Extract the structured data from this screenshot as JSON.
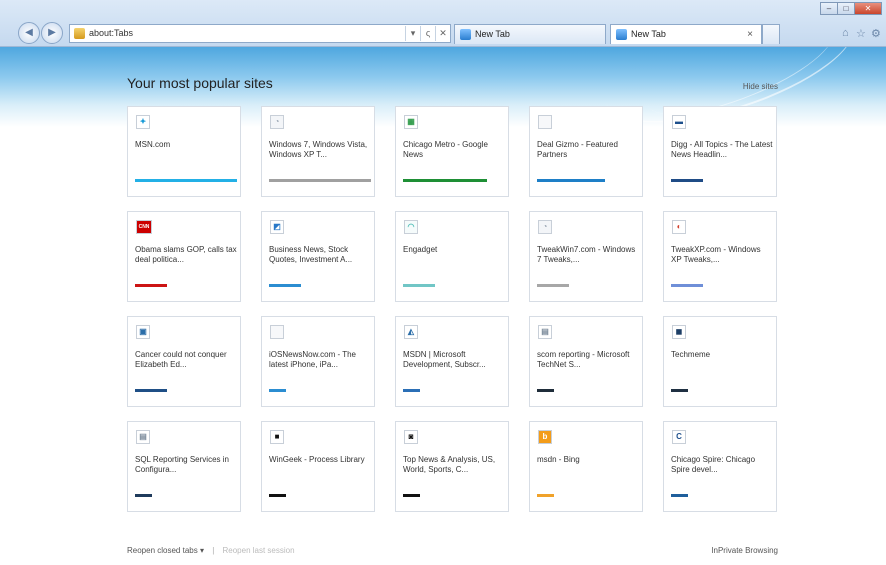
{
  "browser": {
    "address": "about:Tabs",
    "tabs": [
      {
        "label": "New Tab"
      },
      {
        "label": "New Tab"
      }
    ],
    "tab_close": "×",
    "address_controls": [
      "▾",
      "ς",
      "✕"
    ],
    "window_controls": {
      "minimize": "–",
      "maximize": "□",
      "close": "✕"
    }
  },
  "page": {
    "heading": "Your most popular sites",
    "hide_sites": "Hide sites",
    "reopen_closed": "Reopen closed tabs ▾",
    "reopen_last": "Reopen last session",
    "inprivate": "InPrivate Browsing"
  },
  "tiles": [
    {
      "title": "MSN.com",
      "icon": "msn-butterfly-icon",
      "glyph": "✦",
      "icon_color": "#1a9bd7",
      "icon_bg": "#ffffff",
      "bar_color": "#23b0e6",
      "bar_width": 102
    },
    {
      "title": "Windows 7, Windows Vista, Windows XP T...",
      "icon": "generic-page-icon",
      "glyph": "◔",
      "icon_color": "#9aa6b2",
      "icon_bg": "#f3f5f8",
      "bar_color": "#a0a0a0",
      "bar_width": 102
    },
    {
      "title": "Chicago Metro - Google News",
      "icon": "google-news-icon",
      "glyph": "▦",
      "icon_color": "#2f9b4a",
      "icon_bg": "#ffffff",
      "bar_color": "#1e8f35",
      "bar_width": 84
    },
    {
      "title": "Deal Gizmo - Featured Partners",
      "icon": "blank-page-icon",
      "glyph": "",
      "icon_color": "#bbbbbb",
      "icon_bg": "#f7f8fa",
      "bar_color": "#1e7fc7",
      "bar_width": 68
    },
    {
      "title": "Digg - All Topics - The Latest News Headlin...",
      "icon": "digg-icon",
      "glyph": "▬",
      "icon_color": "#1d4f8c",
      "icon_bg": "#ffffff",
      "bar_color": "#1f4c86",
      "bar_width": 32
    },
    {
      "title": "Obama slams GOP, calls tax deal politica...",
      "icon": "cnn-icon",
      "glyph": "CNN",
      "icon_color": "#ffffff",
      "icon_bg": "#cc0000",
      "bar_color": "#cc1414",
      "bar_width": 32
    },
    {
      "title": "Business News, Stock Quotes, Investment A...",
      "icon": "chart-icon",
      "glyph": "◩",
      "icon_color": "#2878c8",
      "icon_bg": "#ffffff",
      "bar_color": "#2b8dd1",
      "bar_width": 32
    },
    {
      "title": "Engadget",
      "icon": "engadget-icon",
      "glyph": "◠",
      "icon_color": "#59c0ba",
      "icon_bg": "#f5fbfb",
      "bar_color": "#71c6c6",
      "bar_width": 32
    },
    {
      "title": "TweakWin7.com - Windows 7 Tweaks,...",
      "icon": "generic-page-icon",
      "glyph": "◔",
      "icon_color": "#9aa6b2",
      "icon_bg": "#f3f5f8",
      "bar_color": "#a7a7a7",
      "bar_width": 32
    },
    {
      "title": "TweakXP.com - Windows XP Tweaks,...",
      "icon": "tweakxp-icon",
      "glyph": "◐",
      "icon_color": "#d2402e",
      "icon_bg": "#ffffff",
      "bar_color": "#6f8fd8",
      "bar_width": 32
    },
    {
      "title": "Cancer could not conquer Elizabeth Ed...",
      "icon": "news-page-icon",
      "glyph": "▣",
      "icon_color": "#2b6ea9",
      "icon_bg": "#ffffff",
      "bar_color": "#1f4f86",
      "bar_width": 32
    },
    {
      "title": "iOSNewsNow.com - The latest iPhone, iPa...",
      "icon": "blank-page-icon",
      "glyph": "",
      "icon_color": "#bbbbbb",
      "icon_bg": "#f7f8fa",
      "bar_color": "#2b8dd1",
      "bar_width": 17
    },
    {
      "title": "MSDN | Microsoft Development, Subscr...",
      "icon": "msdn-icon",
      "glyph": "◭",
      "icon_color": "#2b6ea9",
      "icon_bg": "#ffffff",
      "bar_color": "#2b6fb6",
      "bar_width": 17
    },
    {
      "title": "scom reporting - Microsoft TechNet S...",
      "icon": "technet-icon",
      "glyph": "▤",
      "icon_color": "#7a8a9a",
      "icon_bg": "#ffffff",
      "bar_color": "#1f2d3a",
      "bar_width": 17
    },
    {
      "title": "Techmeme",
      "icon": "techmeme-icon",
      "glyph": "◼",
      "icon_color": "#1d3e66",
      "icon_bg": "#ffffff",
      "bar_color": "#1f3042",
      "bar_width": 17
    },
    {
      "title": "SQL Reporting Services in Configura...",
      "icon": "technet-icon",
      "glyph": "▤",
      "icon_color": "#7a8a9a",
      "icon_bg": "#ffffff",
      "bar_color": "#1f3b5c",
      "bar_width": 17
    },
    {
      "title": "WinGeek - Process Library",
      "icon": "wingeek-icon",
      "glyph": "■",
      "icon_color": "#111111",
      "icon_bg": "#ffffff",
      "bar_color": "#111111",
      "bar_width": 17
    },
    {
      "title": "Top News & Analysis, US, World, Sports, C...",
      "icon": "speech-bubble-icon",
      "glyph": "◙",
      "icon_color": "#111111",
      "icon_bg": "#ffffff",
      "bar_color": "#111111",
      "bar_width": 17
    },
    {
      "title": "msdn - Bing",
      "icon": "bing-icon",
      "glyph": "b",
      "icon_color": "#ffffff",
      "icon_bg": "#f39c1a",
      "bar_color": "#f0a22a",
      "bar_width": 17
    },
    {
      "title": "Chicago Spire: Chicago Spire devel...",
      "icon": "chicago-spire-icon",
      "glyph": "C",
      "icon_color": "#1d4f8c",
      "icon_bg": "#ffffff",
      "bar_color": "#1f5f9c",
      "bar_width": 17
    }
  ]
}
